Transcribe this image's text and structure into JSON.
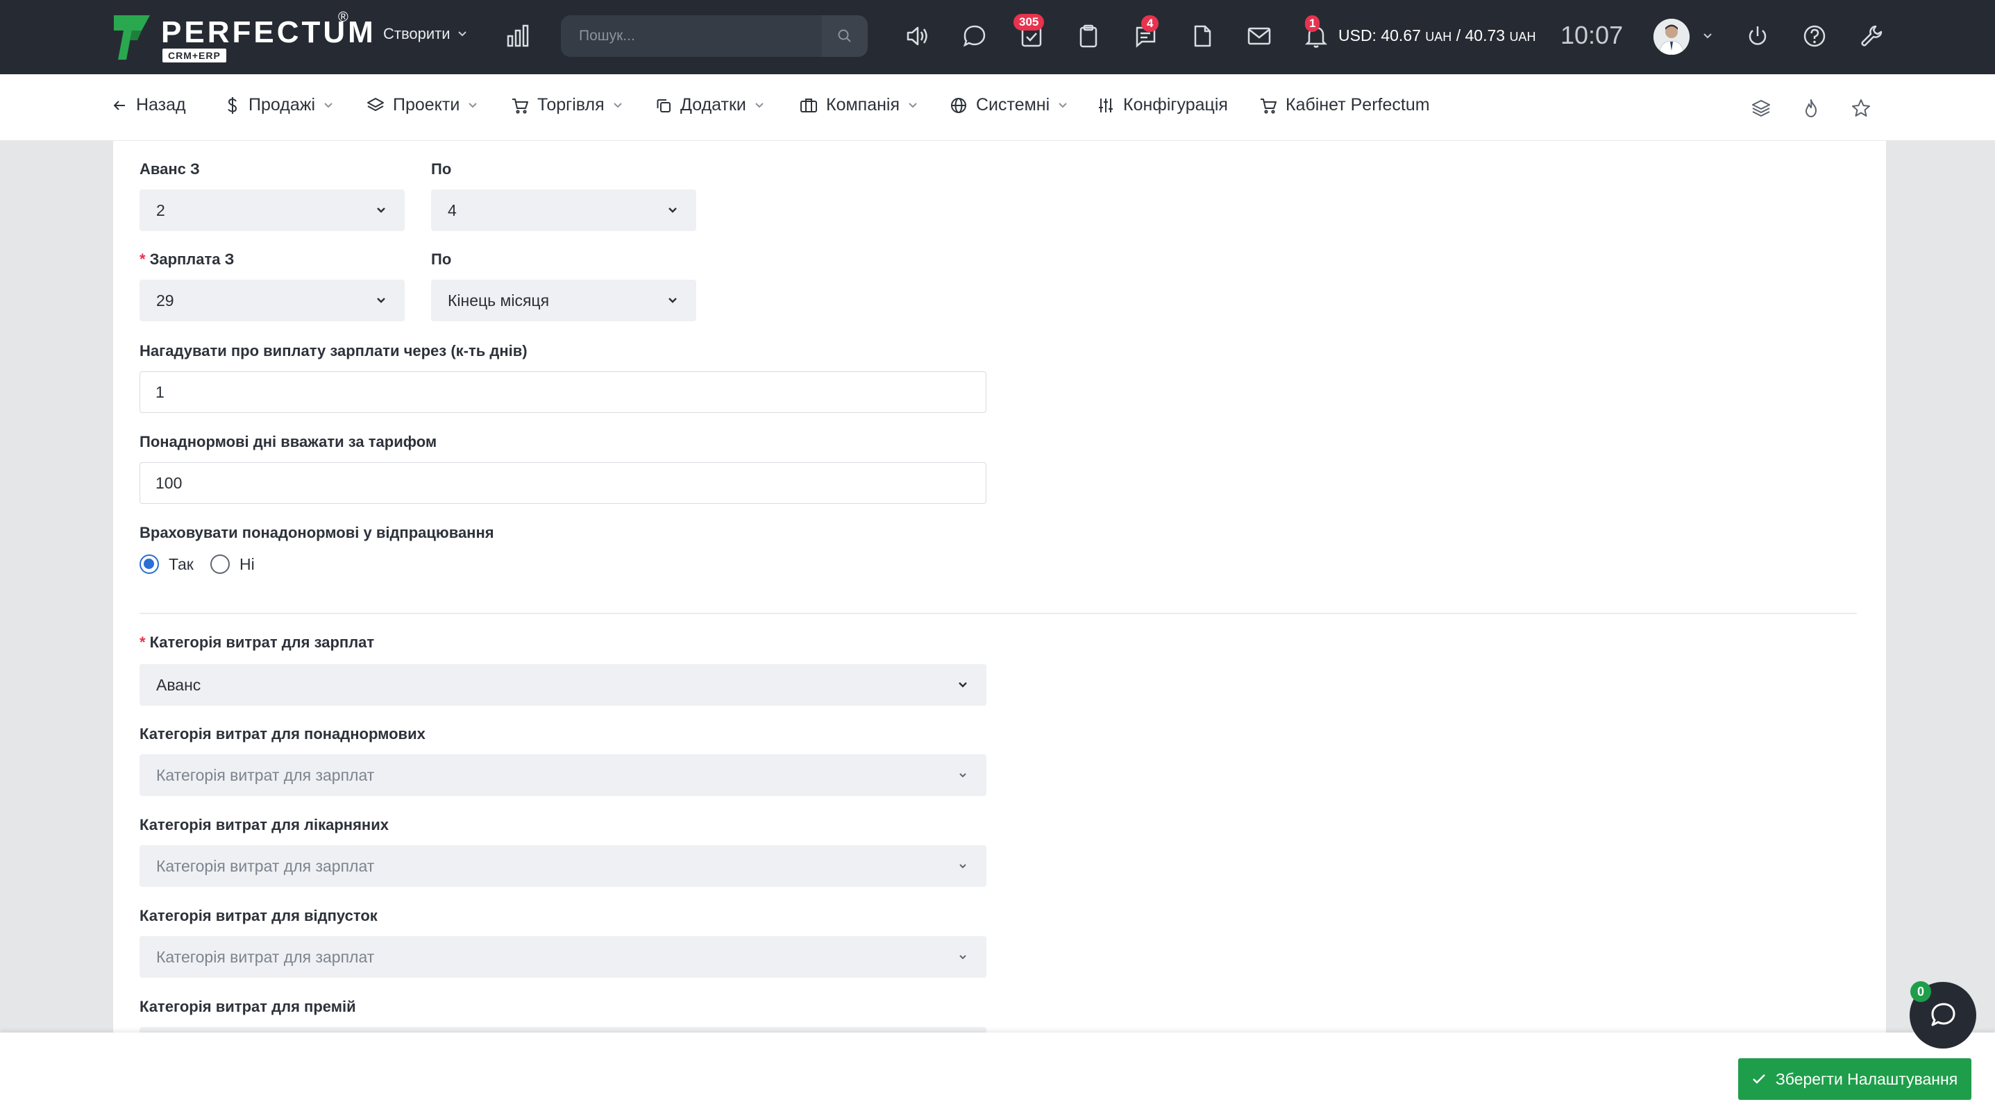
{
  "topbar": {
    "logo_text": "PERFECTUM",
    "logo_reg": "®",
    "logo_sub": "CRM+ERP",
    "create_label": "Створити",
    "search_placeholder": "Пошук...",
    "badges": {
      "tasks": "305",
      "messages": "4",
      "notifications": "1"
    },
    "currency_label": "USD: 40.67",
    "currency_unit1": "UAH",
    "currency_sep": " / 40.73",
    "currency_unit2": "UAH",
    "clock": "10:07"
  },
  "nav": {
    "back": "Назад",
    "sales": "Продажі",
    "projects": "Проекти",
    "trade": "Торгівля",
    "addons": "Додатки",
    "company": "Компанія",
    "system": "Системні",
    "config": "Конфігурація",
    "cabinet": "Кабінет Perfectum"
  },
  "form": {
    "advance_from_label": "Аванс З",
    "advance_from_value": "2",
    "advance_to_label": "По",
    "advance_to_value": "4",
    "salary_from_label": "Зарплата З",
    "salary_from_value": "29",
    "salary_to_label": "По",
    "salary_to_value": "Кінець місяця",
    "remind_label": "Нагадувати про виплату зарплати через (к-ть днів)",
    "remind_value": "1",
    "overtime_rate_label": "Понаднормові дні вважати за тарифом",
    "overtime_rate_value": "100",
    "count_overtime_label": "Враховувати понадонормові у відпрацювання",
    "radio_yes": "Так",
    "radio_no": "Ні",
    "radio_selected": "yes",
    "salary_category_label": "Категорія витрат для зарплат",
    "salary_category_value": "Аванс",
    "overtime_category_label": "Категорія витрат для понаднормових",
    "overtime_category_placeholder": "Категорія витрат для зарплат",
    "sick_category_label": "Категорія витрат для лікарняних",
    "sick_category_placeholder": "Категорія витрат для зарплат",
    "vacation_category_label": "Категорія витрат для відпусток",
    "vacation_category_placeholder": "Категорія витрат для зарплат",
    "bonus_category_label": "Категорія витрат для премій"
  },
  "footer": {
    "save_label": "Зберегти Налаштування",
    "chat_badge": "0"
  },
  "colors": {
    "topbar_bg": "#262b33",
    "accent_blue": "#2b6ed6",
    "save_green": "#1e9e4a",
    "badge_red": "#e8334e",
    "logo_green": "#2aa84f"
  }
}
